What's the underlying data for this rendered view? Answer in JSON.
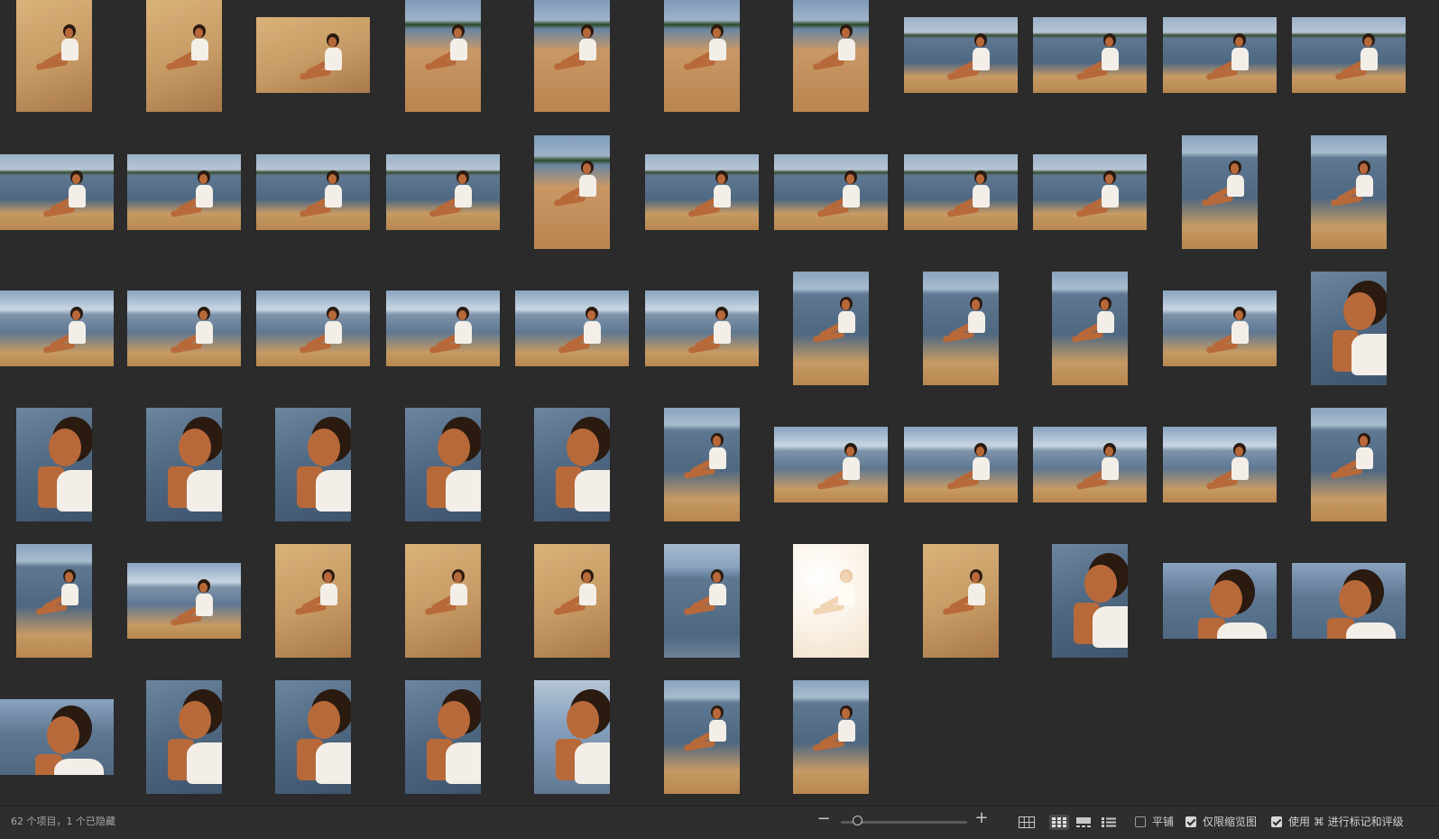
{
  "status": {
    "items_text": "62 个项目，1 个已隐藏"
  },
  "zoom": {
    "minus_label": "−",
    "plus_label": "+",
    "level": 0.1
  },
  "view_modes": {
    "items": [
      {
        "icon": "large-grid-icon",
        "active": false
      },
      {
        "icon": "small-grid-icon",
        "active": true
      },
      {
        "icon": "filmstrip-icon",
        "active": false
      },
      {
        "icon": "list-icon",
        "active": false
      }
    ]
  },
  "options": {
    "tile_label": "平铺",
    "tile_checked": false,
    "thumbs_only_label": "仅限缩览图",
    "thumbs_only_checked": true,
    "use_cmd_label": "使用 ⌘ 进行标记和评级",
    "use_cmd_checked": true
  },
  "palette": {
    "background": "#2b2b2b",
    "statusbar": "#2e2e2e",
    "sky": "#8aa4c0",
    "water": "#5f7892",
    "sand": "#c69a64",
    "skin": "#b8693a",
    "hair": "#2a1a10",
    "shirt": "#f3efe8"
  },
  "grid": {
    "rows": [
      [
        "P",
        "P",
        "L",
        "P",
        "P",
        "P",
        "P",
        "L",
        "L",
        "L",
        "L"
      ],
      [
        "L",
        "L",
        "L",
        "L",
        "P",
        "L",
        "L",
        "L",
        "L",
        "P",
        "P"
      ],
      [
        "L",
        "L",
        "L",
        "L",
        "L",
        "L",
        "P",
        "P",
        "P",
        "L",
        "P"
      ],
      [
        "P",
        "P",
        "P",
        "P",
        "P",
        "P",
        "L",
        "L",
        "L",
        "L",
        "P"
      ],
      [
        "P",
        "L",
        "P",
        "P",
        "P",
        "P",
        "P",
        "P",
        "P",
        "L",
        "L"
      ],
      [
        "L",
        "P",
        "P",
        "P",
        "P",
        "P",
        "P"
      ]
    ],
    "styles": [
      [
        "sand-warm",
        "sand-warm",
        "sand-warm",
        "beach-sunset",
        "beach-sunset",
        "beach-sunset",
        "beach-sunset",
        "sea-sit",
        "sea-sit",
        "sea-sit",
        "sea-sit"
      ],
      [
        "sea-sit",
        "sea-sit",
        "sea-sit",
        "sea-sit",
        "beach-sunset",
        "sea-sit",
        "sea-sit",
        "sea-sit",
        "sea-sit",
        "sea-portrait",
        "sea-portrait"
      ],
      [
        "sea-wide",
        "sea-wide",
        "sea-wide",
        "sea-wide",
        "sea-wide",
        "sea-wide",
        "sea-portrait",
        "sea-portrait",
        "sea-portrait",
        "sea-wide",
        "closeup"
      ],
      [
        "closeup",
        "closeup",
        "closeup",
        "closeup",
        "closeup",
        "sea-portrait",
        "sea-wide",
        "sea-wide",
        "sea-wide",
        "sea-wide",
        "sea-portrait"
      ],
      [
        "sea-portrait",
        "sea-wide",
        "sand-warm",
        "sand-warm",
        "sand-warm",
        "sea-standing",
        "bright-white",
        "sand-warm",
        "closeup",
        "closeup-sea",
        "closeup-sea"
      ],
      [
        "closeup-sea",
        "closeup",
        "closeup",
        "closeup",
        "closeup-sun",
        "sea-portrait",
        "sea-portrait"
      ]
    ]
  }
}
